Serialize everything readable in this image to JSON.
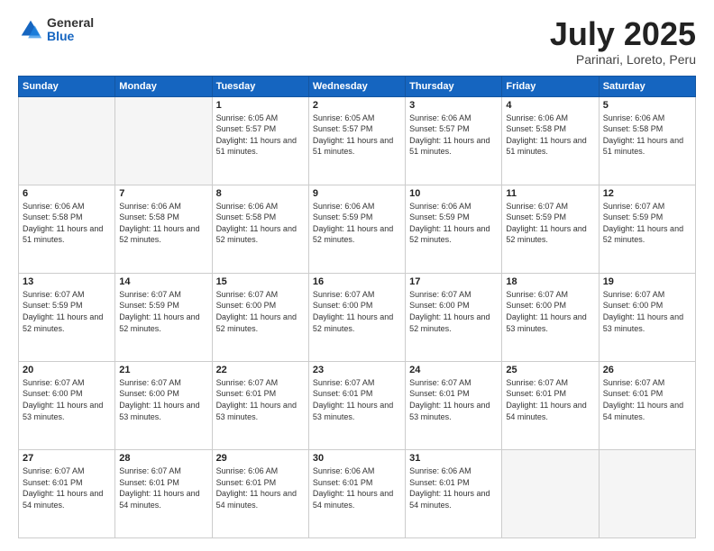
{
  "logo": {
    "general": "General",
    "blue": "Blue"
  },
  "title": {
    "month": "July 2025",
    "location": "Parinari, Loreto, Peru"
  },
  "weekdays": [
    "Sunday",
    "Monday",
    "Tuesday",
    "Wednesday",
    "Thursday",
    "Friday",
    "Saturday"
  ],
  "weeks": [
    [
      {
        "day": "",
        "empty": true
      },
      {
        "day": "",
        "empty": true
      },
      {
        "day": "1",
        "sunrise": "6:05 AM",
        "sunset": "5:57 PM",
        "daylight": "11 hours and 51 minutes."
      },
      {
        "day": "2",
        "sunrise": "6:05 AM",
        "sunset": "5:57 PM",
        "daylight": "11 hours and 51 minutes."
      },
      {
        "day": "3",
        "sunrise": "6:06 AM",
        "sunset": "5:57 PM",
        "daylight": "11 hours and 51 minutes."
      },
      {
        "day": "4",
        "sunrise": "6:06 AM",
        "sunset": "5:58 PM",
        "daylight": "11 hours and 51 minutes."
      },
      {
        "day": "5",
        "sunrise": "6:06 AM",
        "sunset": "5:58 PM",
        "daylight": "11 hours and 51 minutes."
      }
    ],
    [
      {
        "day": "6",
        "sunrise": "6:06 AM",
        "sunset": "5:58 PM",
        "daylight": "11 hours and 51 minutes."
      },
      {
        "day": "7",
        "sunrise": "6:06 AM",
        "sunset": "5:58 PM",
        "daylight": "11 hours and 52 minutes."
      },
      {
        "day": "8",
        "sunrise": "6:06 AM",
        "sunset": "5:58 PM",
        "daylight": "11 hours and 52 minutes."
      },
      {
        "day": "9",
        "sunrise": "6:06 AM",
        "sunset": "5:59 PM",
        "daylight": "11 hours and 52 minutes."
      },
      {
        "day": "10",
        "sunrise": "6:06 AM",
        "sunset": "5:59 PM",
        "daylight": "11 hours and 52 minutes."
      },
      {
        "day": "11",
        "sunrise": "6:07 AM",
        "sunset": "5:59 PM",
        "daylight": "11 hours and 52 minutes."
      },
      {
        "day": "12",
        "sunrise": "6:07 AM",
        "sunset": "5:59 PM",
        "daylight": "11 hours and 52 minutes."
      }
    ],
    [
      {
        "day": "13",
        "sunrise": "6:07 AM",
        "sunset": "5:59 PM",
        "daylight": "11 hours and 52 minutes."
      },
      {
        "day": "14",
        "sunrise": "6:07 AM",
        "sunset": "5:59 PM",
        "daylight": "11 hours and 52 minutes."
      },
      {
        "day": "15",
        "sunrise": "6:07 AM",
        "sunset": "6:00 PM",
        "daylight": "11 hours and 52 minutes."
      },
      {
        "day": "16",
        "sunrise": "6:07 AM",
        "sunset": "6:00 PM",
        "daylight": "11 hours and 52 minutes."
      },
      {
        "day": "17",
        "sunrise": "6:07 AM",
        "sunset": "6:00 PM",
        "daylight": "11 hours and 52 minutes."
      },
      {
        "day": "18",
        "sunrise": "6:07 AM",
        "sunset": "6:00 PM",
        "daylight": "11 hours and 53 minutes."
      },
      {
        "day": "19",
        "sunrise": "6:07 AM",
        "sunset": "6:00 PM",
        "daylight": "11 hours and 53 minutes."
      }
    ],
    [
      {
        "day": "20",
        "sunrise": "6:07 AM",
        "sunset": "6:00 PM",
        "daylight": "11 hours and 53 minutes."
      },
      {
        "day": "21",
        "sunrise": "6:07 AM",
        "sunset": "6:00 PM",
        "daylight": "11 hours and 53 minutes."
      },
      {
        "day": "22",
        "sunrise": "6:07 AM",
        "sunset": "6:01 PM",
        "daylight": "11 hours and 53 minutes."
      },
      {
        "day": "23",
        "sunrise": "6:07 AM",
        "sunset": "6:01 PM",
        "daylight": "11 hours and 53 minutes."
      },
      {
        "day": "24",
        "sunrise": "6:07 AM",
        "sunset": "6:01 PM",
        "daylight": "11 hours and 53 minutes."
      },
      {
        "day": "25",
        "sunrise": "6:07 AM",
        "sunset": "6:01 PM",
        "daylight": "11 hours and 54 minutes."
      },
      {
        "day": "26",
        "sunrise": "6:07 AM",
        "sunset": "6:01 PM",
        "daylight": "11 hours and 54 minutes."
      }
    ],
    [
      {
        "day": "27",
        "sunrise": "6:07 AM",
        "sunset": "6:01 PM",
        "daylight": "11 hours and 54 minutes."
      },
      {
        "day": "28",
        "sunrise": "6:07 AM",
        "sunset": "6:01 PM",
        "daylight": "11 hours and 54 minutes."
      },
      {
        "day": "29",
        "sunrise": "6:06 AM",
        "sunset": "6:01 PM",
        "daylight": "11 hours and 54 minutes."
      },
      {
        "day": "30",
        "sunrise": "6:06 AM",
        "sunset": "6:01 PM",
        "daylight": "11 hours and 54 minutes."
      },
      {
        "day": "31",
        "sunrise": "6:06 AM",
        "sunset": "6:01 PM",
        "daylight": "11 hours and 54 minutes."
      },
      {
        "day": "",
        "empty": true
      },
      {
        "day": "",
        "empty": true
      }
    ]
  ]
}
